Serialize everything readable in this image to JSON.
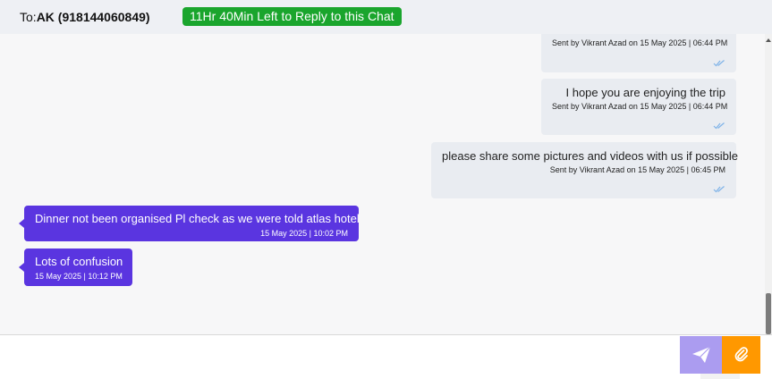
{
  "header": {
    "to_prefix": "To:",
    "recipient": "AK (918144060849)",
    "reply_timer": "11Hr 40Min Left to Reply to this Chat"
  },
  "messages": [
    {
      "direction": "outgoing",
      "text": "",
      "meta": "Sent by Vikrant Azad on 15 May 2025 | 06:44 PM",
      "ticks": "double-check-icon"
    },
    {
      "direction": "outgoing",
      "text": "I hope you are enjoying the trip",
      "meta": "Sent by Vikrant Azad on 15 May 2025 | 06:44 PM",
      "ticks": "double-check-icon"
    },
    {
      "direction": "outgoing",
      "text": "please share some pictures and videos with us if possible",
      "meta": "Sent by Vikrant Azad on 15 May 2025 | 06:45 PM",
      "ticks": "double-check-icon"
    },
    {
      "direction": "incoming",
      "text": "Dinner not been organised Pl check as we were told atlas hotel",
      "meta": "15 May 2025 | 10:02 PM"
    },
    {
      "direction": "incoming",
      "text": "Lots of confusion",
      "meta": "15 May 2025 | 10:12 PM"
    }
  ],
  "composer": {
    "placeholder": "",
    "send_icon": "paper-plane-icon",
    "attach_icon": "paperclip-icon"
  },
  "colors": {
    "header_bg": "#eef0f4",
    "timer_badge": "#1aa52d",
    "outgoing_bubble": "#e9ecf1",
    "incoming_bubble": "#5a35e0",
    "send_button": "#ab9cf0",
    "attach_button": "#ff9800",
    "tick_color": "#7fb3e8"
  }
}
